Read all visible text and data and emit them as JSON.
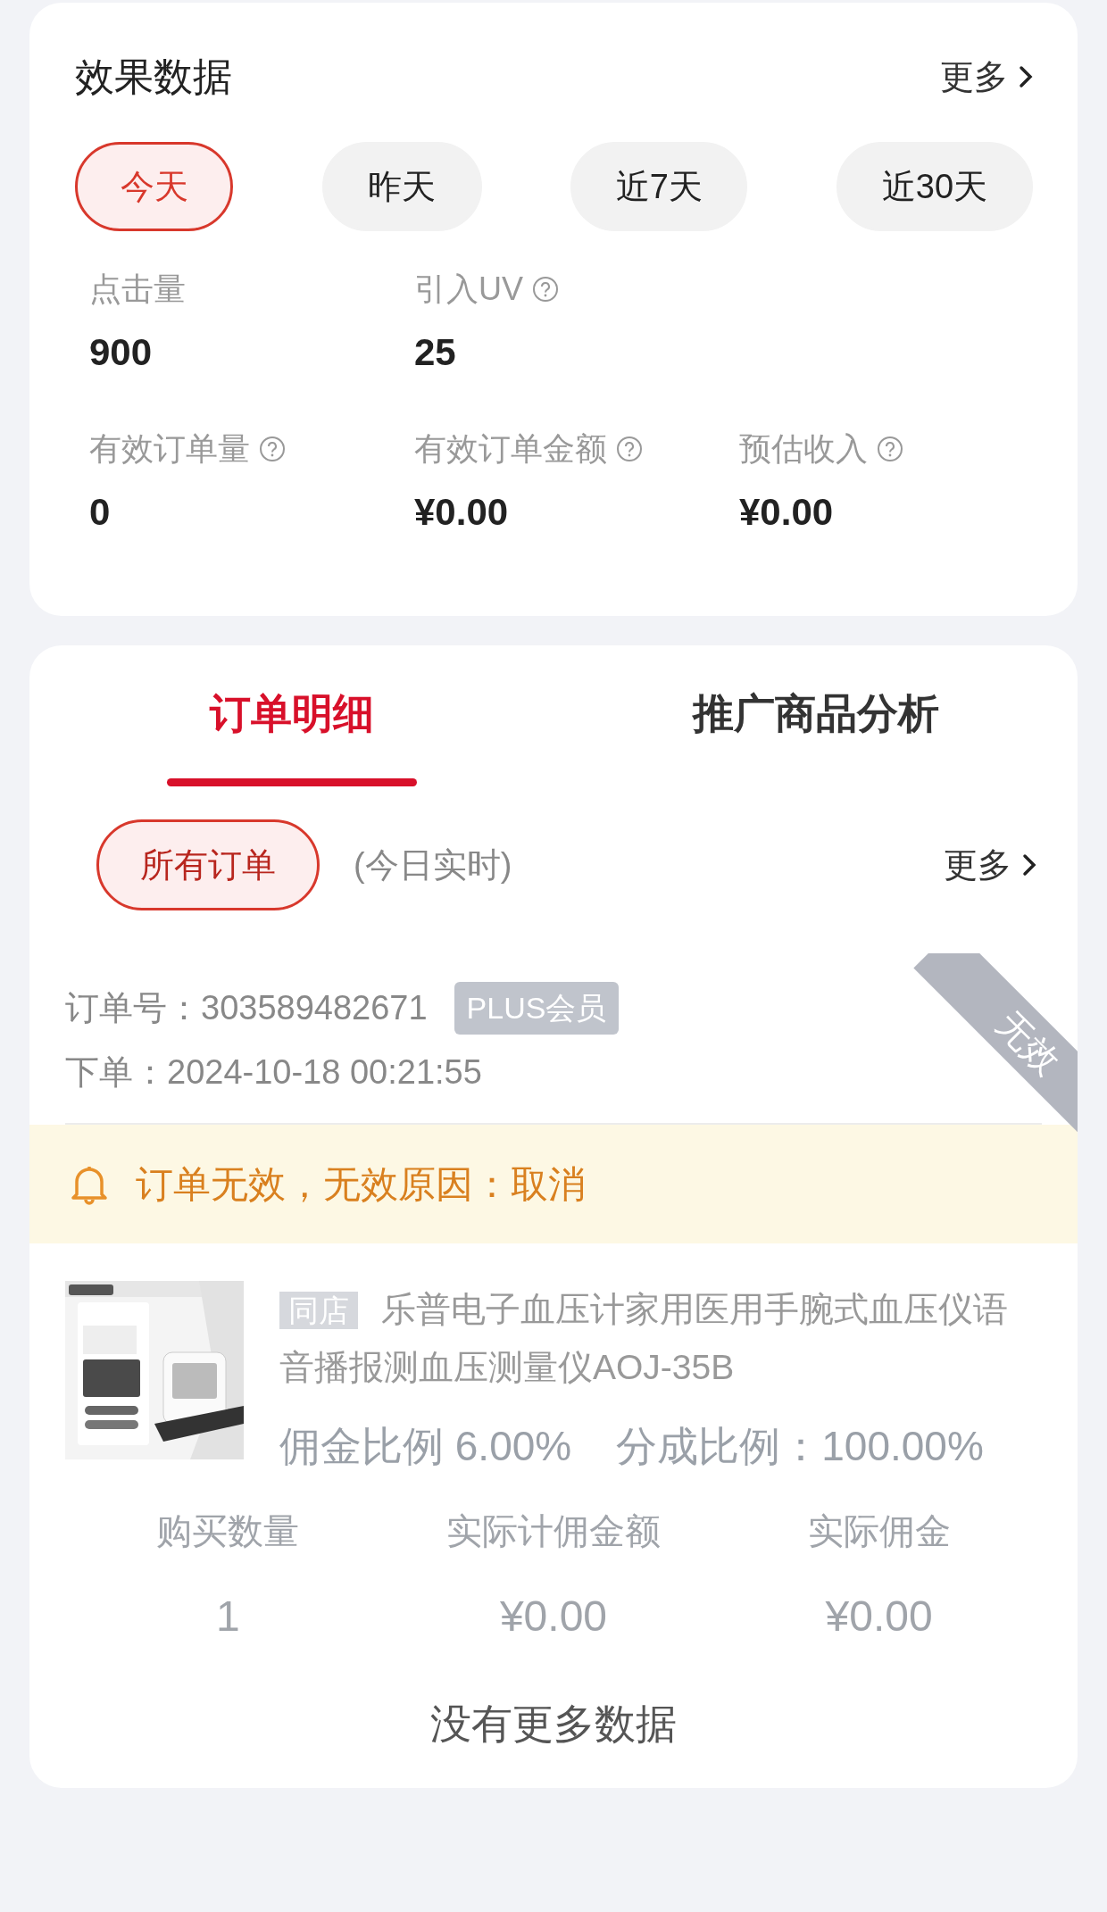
{
  "effect_panel": {
    "title": "效果数据",
    "more": "更多",
    "ranges": [
      {
        "label": "今天",
        "selected": true
      },
      {
        "label": "昨天",
        "selected": false
      },
      {
        "label": "近7天",
        "selected": false
      },
      {
        "label": "近30天",
        "selected": false
      }
    ],
    "metrics": [
      {
        "label": "点击量",
        "value": "900",
        "help": false
      },
      {
        "label": "引入UV",
        "value": "25",
        "help": true
      },
      {
        "label": "有效订单量",
        "value": "0",
        "help": true
      },
      {
        "label": "有效订单金额",
        "value": "¥0.00",
        "help": true
      },
      {
        "label": "预估收入",
        "value": "¥0.00",
        "help": true
      }
    ]
  },
  "order_panel": {
    "tabs": [
      {
        "label": "订单明细",
        "selected": true
      },
      {
        "label": "推广商品分析",
        "selected": false
      }
    ],
    "filter": {
      "label": "所有订单",
      "selected": true
    },
    "filter_note": "(今日实时)",
    "more": "更多",
    "orders": [
      {
        "order_no_label": "订单号：",
        "order_no": "303589482671",
        "member_badge": "PLUS会员",
        "placed_label": "下单：",
        "placed_at": "2024-10-18 00:21:55",
        "status_ribbon": "无效",
        "notice": "订单无效，无效原因：取消",
        "product": {
          "shop_tag": "同店",
          "title": "乐普电子血压计家用医用手腕式血压仪语音播报测血压测量仪AOJ-35B",
          "commission_rate": "佣金比例 6.00%",
          "share_rate": "分成比例：100.00%"
        },
        "stats": [
          {
            "label": "购买数量",
            "value": "1"
          },
          {
            "label": "实际计佣金额",
            "value": "¥0.00"
          },
          {
            "label": "实际佣金",
            "value": "¥0.00"
          }
        ]
      }
    ],
    "end_text": "没有更多数据"
  }
}
